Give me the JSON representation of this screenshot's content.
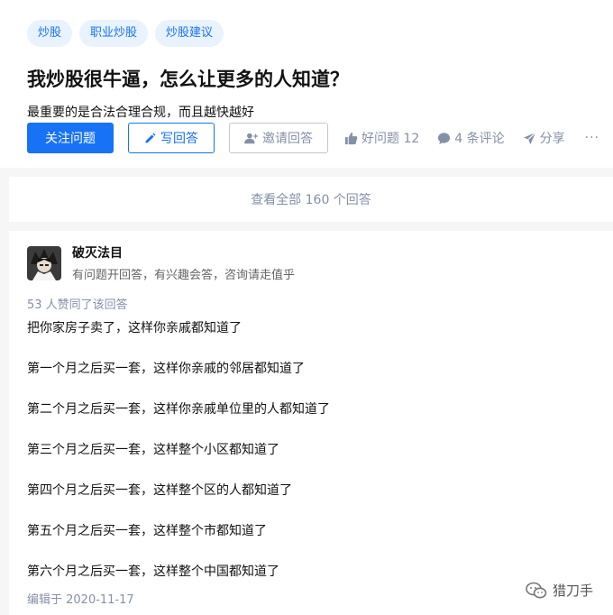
{
  "question": {
    "topics": [
      "炒股",
      "职业炒股",
      "炒股建议"
    ],
    "title": "我炒股很牛逼，怎么让更多的人知道？",
    "detail": "最重要的是合法合理合规，而且越快越好",
    "follow_label": "关注问题",
    "write_label": "写回答",
    "invite_label": "邀请回答",
    "good_question_label": "好问题 12",
    "comments_label": "4 条评论",
    "share_label": "分享",
    "more_label": "···"
  },
  "view_all": "查看全部 160 个回答",
  "answer": {
    "author_name": "破灭法目",
    "author_bio": "有问题开回答，有兴趣会答，咨询请走值乎",
    "votes": "53 人赞同了该回答",
    "paragraphs": [
      "把你家房子卖了，这样你亲戚都知道了",
      "第一个月之后买一套，这样你亲戚的邻居都知道了",
      "第二个月之后买一套，这样你亲戚单位里的人都知道了",
      "第三个月之后买一套，这样整个小区都知道了",
      "第四个月之后买一套，这样整个区的人都知道了",
      "第五个月之后买一套，这样整个市都知道了",
      "第六个月之后买一套，这样整个中国都知道了"
    ],
    "edited": "编辑于 2020-11-17"
  },
  "watermark": "猎刀手",
  "colors": {
    "accent": "#1772f6",
    "muted": "#8590a6",
    "topic_bg": "#e9f2ff"
  }
}
